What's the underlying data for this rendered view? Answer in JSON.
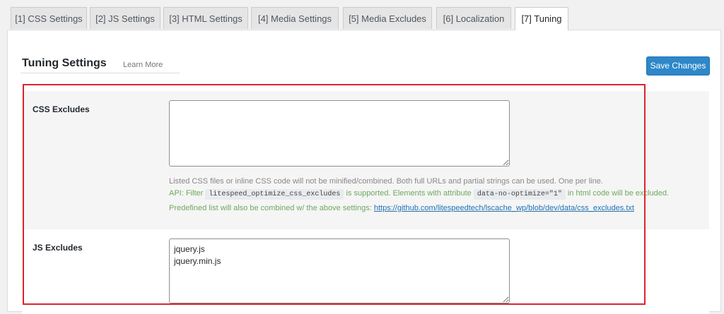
{
  "tabs": [
    {
      "label": "[1] CSS Settings"
    },
    {
      "label": "[2] JS Settings"
    },
    {
      "label": "[3] HTML Settings"
    },
    {
      "label": "[4] Media Settings"
    },
    {
      "label": "[5] Media Excludes"
    },
    {
      "label": "[6] Localization"
    },
    {
      "label": "[7] Tuning",
      "active": true
    }
  ],
  "header": {
    "title": "Tuning Settings",
    "learn_more": "Learn More",
    "save_label": "Save Changes"
  },
  "css_excludes": {
    "label": "CSS Excludes",
    "value": "",
    "desc1": "Listed CSS files or inline CSS code will not be minified/combined. Both full URLs and partial strings can be used. One per line.",
    "desc2_pre": "API: Filter",
    "desc2_code1": "litespeed_optimize_css_excludes",
    "desc2_mid": "is supported. Elements with attribute",
    "desc2_code2": "data-no-optimize=\"1\"",
    "desc2_post": "in html code will be excluded.",
    "desc3_pre": "Predefined list will also be combined w/ the above settings:",
    "desc3_link": "https://github.com/litespeedtech/lscache_wp/blob/dev/data/css_excludes.txt"
  },
  "js_excludes": {
    "label": "JS Excludes",
    "value": "jquery.js\njquery.min.js"
  },
  "colors": {
    "accent": "#2e87c9",
    "highlight": "#d9252f",
    "green_text": "#6fa85f"
  }
}
